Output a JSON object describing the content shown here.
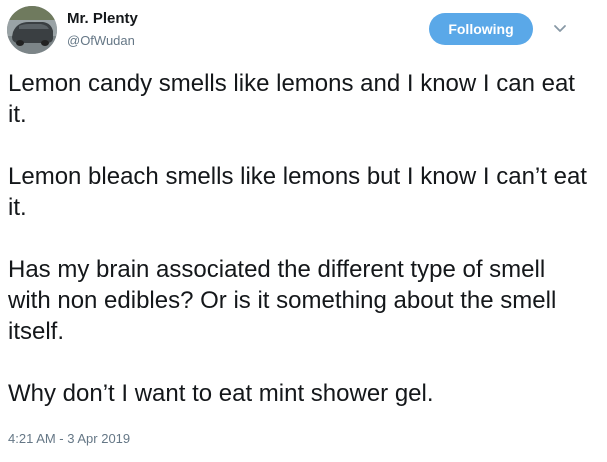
{
  "user": {
    "display_name": "Mr. Plenty",
    "handle": "@OfWudan"
  },
  "follow_button": {
    "label": "Following",
    "color": "#5aa8e8"
  },
  "menu": {
    "icon": "chevron-down-icon"
  },
  "tweet": {
    "paragraphs": [
      "Lemon candy smells like lemons and I know I can eat it.",
      "Lemon bleach smells like lemons but I know I can’t eat it.",
      "Has my brain associated the different type of smell with non edibles? Or is it something about the smell itself.",
      "Why don’t I want to eat mint shower gel."
    ],
    "timestamp": "4:21 AM - 3 Apr 2019"
  }
}
